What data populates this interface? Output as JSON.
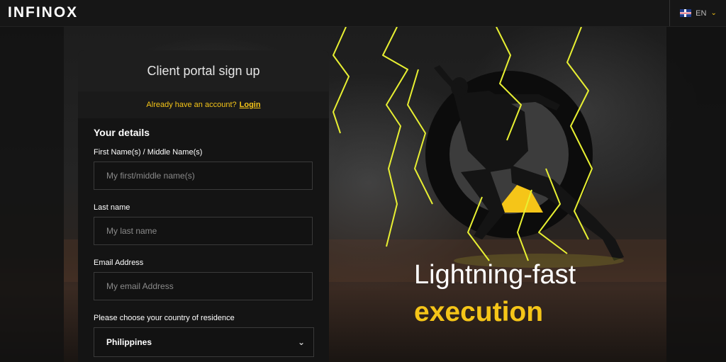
{
  "nav": {
    "logo": "INFINOX",
    "language": "EN",
    "flag_icon": "uk-flag-icon",
    "chevron_icon": "chevron-down-icon"
  },
  "hero": {
    "headline_line1": "Lightning-fast",
    "headline_line2": "execution",
    "accent_color": "#f5c518"
  },
  "form": {
    "title": "Client portal sign up",
    "login_prompt": "Already have an account?",
    "login_link": "Login",
    "section_title": "Your details",
    "first_name_label": "First Name(s) / Middle Name(s)",
    "first_name_placeholder": "My first/middle name(s)",
    "last_name_label": "Last name",
    "last_name_placeholder": "My last name",
    "email_label": "Email Address",
    "email_placeholder": "My email Address",
    "country_label": "Please choose your country of residence",
    "country_value": "Philippines"
  }
}
